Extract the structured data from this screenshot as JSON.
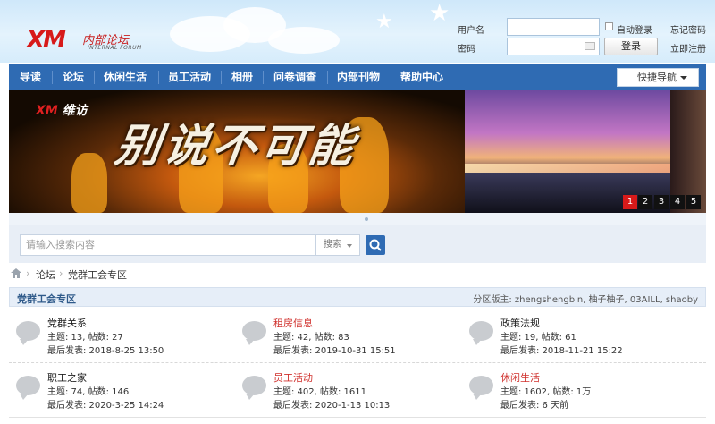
{
  "header": {
    "logo_mark": "XM",
    "logo_name": "内部论坛",
    "logo_sub": "INTERNAL FORUM",
    "username_label": "用户名",
    "password_label": "密码",
    "auto_login_label": "自动登录",
    "forgot_password": "忘记密码",
    "register": "立即注册",
    "login_button": "登录"
  },
  "nav": {
    "items": [
      "导读",
      "论坛",
      "休闲生活",
      "员工活动",
      "相册",
      "问卷调查",
      "内部刊物",
      "帮助中心"
    ],
    "quick_nav": "快捷导航"
  },
  "banner": {
    "brand_mark": "XM",
    "brand_name": "维访",
    "slogan": "别说不可能",
    "pages": [
      "1",
      "2",
      "3",
      "4",
      "5"
    ],
    "active_page": 1
  },
  "search": {
    "placeholder": "请输入搜索内容",
    "type_label": "搜索"
  },
  "breadcrumb": {
    "items": [
      "论坛",
      "党群工会专区"
    ]
  },
  "category": {
    "title": "党群工会专区",
    "moderators": "分区版主: zhengshengbin, 柚子柚子, 03AILL, shaoby",
    "forums": [
      {
        "name": "党群关系",
        "stats": "主题: 13, 帖数: 27",
        "last": "最后发表: 2018-8-25 13:50",
        "hot": false
      },
      {
        "name": "租房信息",
        "stats": "主题: 42, 帖数: 83",
        "last": "最后发表: 2019-10-31 15:51",
        "hot": true
      },
      {
        "name": "政策法规",
        "stats": "主题: 19, 帖数: 61",
        "last": "最后发表: 2018-11-21 15:22",
        "hot": false
      },
      {
        "name": "职工之家",
        "stats": "主题: 74, 帖数: 146",
        "last": "最后发表: 2020-3-25 14:24",
        "hot": false
      },
      {
        "name": "员工活动",
        "stats": "主题: 402, 帖数: 1611",
        "last": "最后发表: 2020-1-13 10:13",
        "hot": true
      },
      {
        "name": "休闲生活",
        "stats": "主题: 1602, 帖数: 1万",
        "last": "最后发表: 6 天前",
        "hot": true
      }
    ]
  },
  "colors": {
    "nav_bg": "#2f6bb3",
    "brand_red": "#d71a1a",
    "hot_forum": "#d0312d"
  }
}
